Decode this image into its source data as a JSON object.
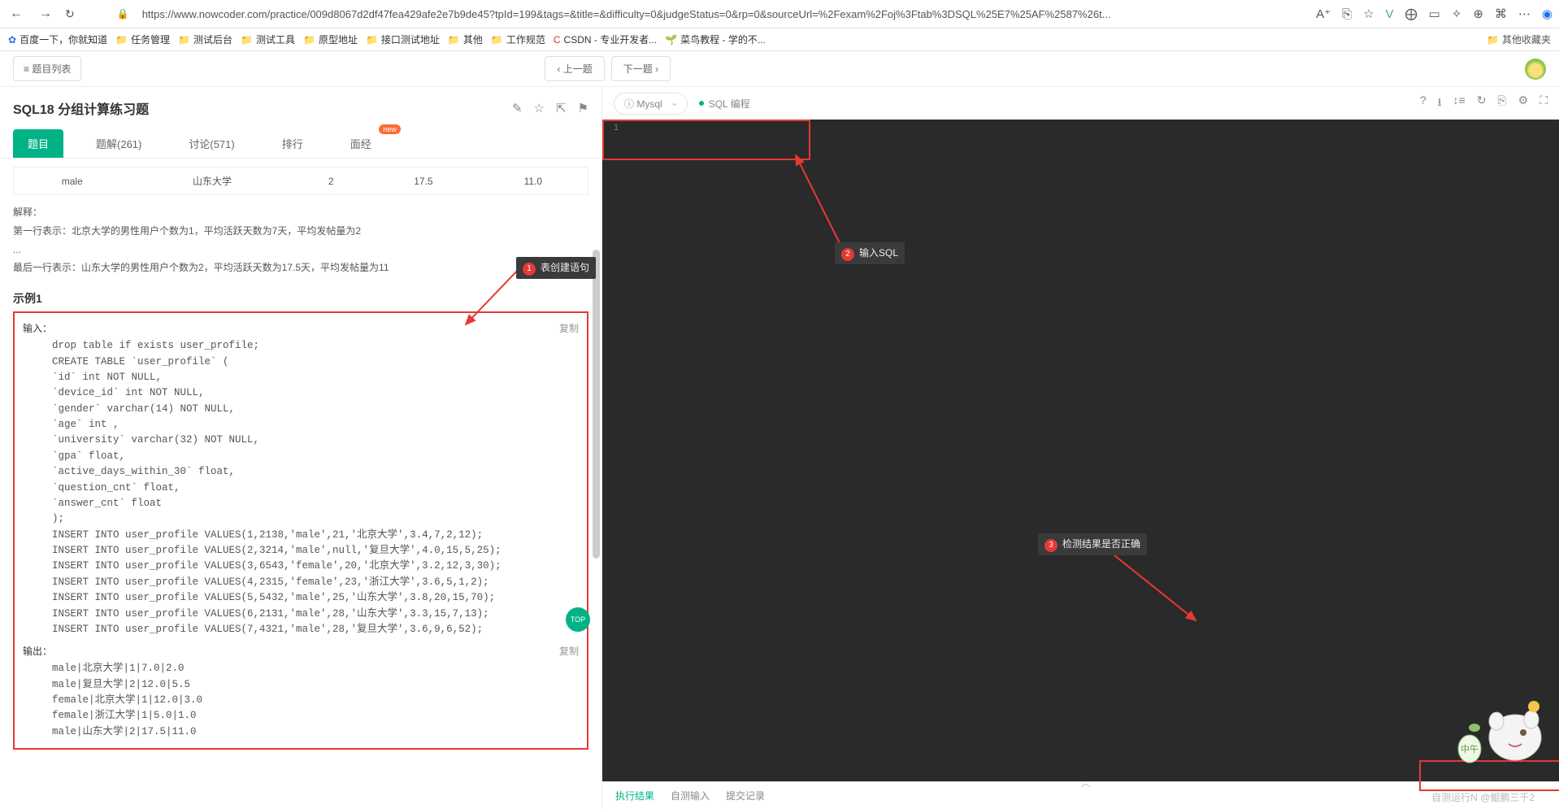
{
  "browser": {
    "url": "https://www.nowcoder.com/practice/009d8067d2df47fea429afe2e7b9de45?tpId=199&tags=&title=&difficulty=0&judgeStatus=0&rp=0&sourceUrl=%2Fexam%2Foj%3Ftab%3DSQL%25E7%25AF%2587%26t..."
  },
  "bookmarks": {
    "b1": "百度一下，你就知道",
    "b2": "任务管理",
    "b3": "测试后台",
    "b4": "测试工具",
    "b5": "原型地址",
    "b6": "接口测试地址",
    "b7": "其他",
    "b8": "工作规范",
    "b9": "CSDN - 专业开发者...",
    "b10": "菜鸟教程 - 学的不...",
    "other": "其他收藏夹"
  },
  "topnav": {
    "list": "题目列表",
    "prev": "上一题",
    "next": "下一题"
  },
  "problem": {
    "title": "SQL18  分组计算练习题",
    "tabs": {
      "t1": "题目",
      "t2": "题解(261)",
      "t3": "讨论(571)",
      "t4": "排行",
      "t5": "面经",
      "new": "new"
    },
    "row": {
      "c1": "male",
      "c2": "山东大学",
      "c3": "2",
      "c4": "17.5",
      "c5": "11.0"
    },
    "exp_label": "解释：",
    "exp_line1": "第一行表示：北京大学的男性用户个数为1，平均活跃天数为7天，平均发帖量为2",
    "dots": "...",
    "exp_line2": "最后一行表示：山东大学的男性用户个数为2，平均活跃天数为17.5天，平均发帖量为11",
    "example_title": "示例1",
    "input_label": "输入：",
    "output_label": "输出：",
    "copy": "复制",
    "sql_input": "drop table if exists user_profile;\nCREATE TABLE `user_profile` (\n`id` int NOT NULL,\n`device_id` int NOT NULL,\n`gender` varchar(14) NOT NULL,\n`age` int ,\n`university` varchar(32) NOT NULL,\n`gpa` float,\n`active_days_within_30` float,\n`question_cnt` float,\n`answer_cnt` float\n);\nINSERT INTO user_profile VALUES(1,2138,'male',21,'北京大学',3.4,7,2,12);\nINSERT INTO user_profile VALUES(2,3214,'male',null,'复旦大学',4.0,15,5,25);\nINSERT INTO user_profile VALUES(3,6543,'female',20,'北京大学',3.2,12,3,30);\nINSERT INTO user_profile VALUES(4,2315,'female',23,'浙江大学',3.6,5,1,2);\nINSERT INTO user_profile VALUES(5,5432,'male',25,'山东大学',3.8,20,15,70);\nINSERT INTO user_profile VALUES(6,2131,'male',28,'山东大学',3.3,15,7,13);\nINSERT INTO user_profile VALUES(7,4321,'male',28,'复旦大学',3.6,9,6,52);",
    "sql_output": "male|北京大学|1|7.0|2.0\nmale|复旦大学|2|12.0|5.5\nfemale|北京大学|1|12.0|3.0\nfemale|浙江大学|1|5.0|1.0\nmale|山东大学|2|17.5|11.0"
  },
  "anno": {
    "a1": "表创建语句",
    "a2": "输入SQL",
    "a3": "检测结果是否正确"
  },
  "editor": {
    "db": "Mysql",
    "mode": "SQL 编程",
    "line": "1"
  },
  "bottom": {
    "t1": "执行结果",
    "t2": "自测输入",
    "t3": "提交记录"
  },
  "watermark": "自测运行N @鲲鹏三千2",
  "scrolltop": "TOP"
}
